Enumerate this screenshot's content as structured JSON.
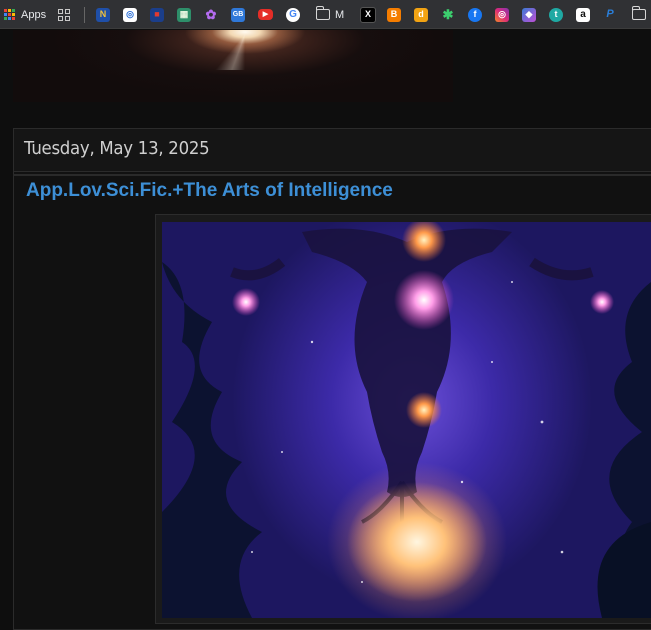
{
  "bookmarks_bar": {
    "apps_label": "Apps",
    "folder_m_label": "M",
    "items": [
      {
        "icon": "n-icon",
        "glyph": "N",
        "color": "#1f4fa8"
      },
      {
        "icon": "spiral-icon",
        "glyph": "◎",
        "color": "#ffffff"
      },
      {
        "icon": "square-logo-icon",
        "glyph": "■",
        "color": "#c0302c"
      },
      {
        "icon": "checker-icon",
        "glyph": "▦",
        "color": "#2e8f6a"
      },
      {
        "icon": "colorful-logo-icon",
        "glyph": "✿",
        "color": "#6b4ccc"
      },
      {
        "icon": "gb-icon",
        "glyph": "GB",
        "color": "#2f78d8"
      },
      {
        "icon": "youtube-icon",
        "glyph": "▶",
        "color": "#e52d27"
      },
      {
        "icon": "google-icon",
        "glyph": "G",
        "color": "#ffffff"
      },
      {
        "icon": "x-icon",
        "glyph": "X",
        "color": "#000000"
      },
      {
        "icon": "blogger-icon",
        "glyph": "B",
        "color": "#f57d00"
      },
      {
        "icon": "d-icon",
        "glyph": "d",
        "color": "#f2a313"
      },
      {
        "icon": "asterisk-icon",
        "glyph": "✱",
        "color": "#2a7b4f"
      },
      {
        "icon": "facebook-icon",
        "glyph": "f",
        "color": "#1877f2"
      },
      {
        "icon": "instagram-icon",
        "glyph": "◎",
        "color": "#d6249f"
      },
      {
        "icon": "copilot-icon",
        "glyph": "◆",
        "color": "#3a7bd5"
      },
      {
        "icon": "t-icon",
        "glyph": "t",
        "color": "#1fa9a3"
      },
      {
        "icon": "amazon-icon",
        "glyph": "a",
        "color": "#ffffff"
      },
      {
        "icon": "paypal-icon",
        "glyph": "P",
        "color": "#003087"
      }
    ]
  },
  "post": {
    "date": "Tuesday, May 13, 2025",
    "title": "App.Lov.Sci.Fic.+The Arts of Intelligence"
  },
  "colors": {
    "title_link": "#3d8fd6",
    "page_background": "#0e0e0e",
    "toolbar": "#303134"
  }
}
